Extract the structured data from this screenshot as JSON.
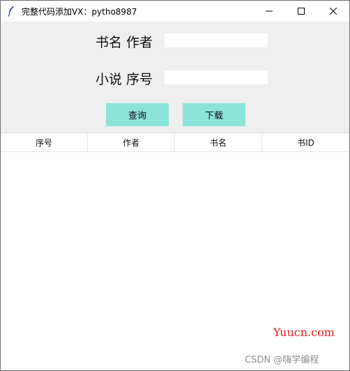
{
  "window": {
    "title": "完整代码添加VX：pytho8987",
    "icon": "feather-icon",
    "controls": [
      "minimize-icon",
      "maximize-icon",
      "close-icon"
    ]
  },
  "form": {
    "label_1": "书名 作者",
    "entry_1_value": "",
    "label_2": "小说 序号",
    "entry_2_value": "",
    "query_button": "查询",
    "download_button": "下载"
  },
  "table": {
    "columns": [
      "序号",
      "作者",
      "书名",
      "书ID"
    ],
    "rows": []
  },
  "watermarks": {
    "site": "Yuucn.com",
    "csdn": "CSDN @嗨学编程"
  },
  "colors": {
    "form_background": "#efefef",
    "button_background": "#8ce3d8",
    "watermark_red": "#e02020"
  }
}
